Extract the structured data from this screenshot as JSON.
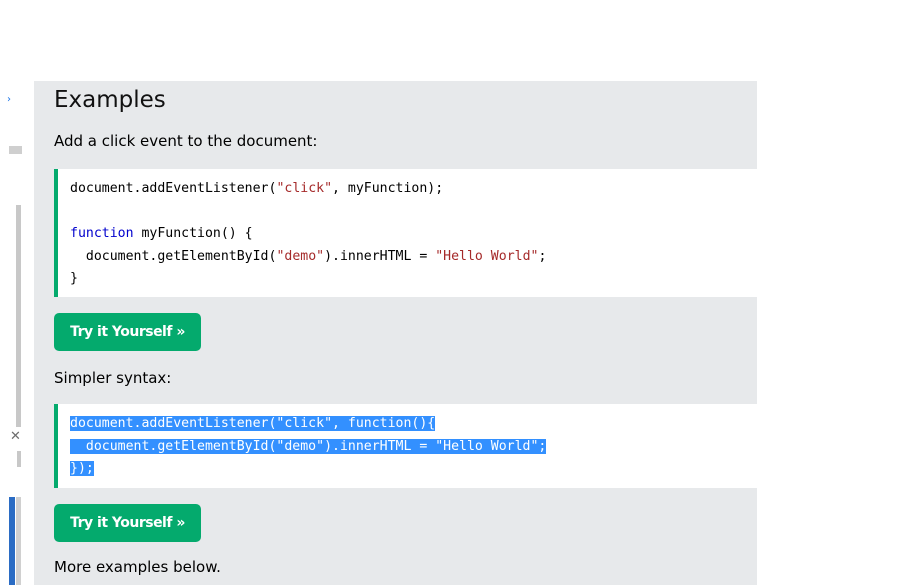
{
  "left_chrome": {
    "close_glyph": "✕"
  },
  "main": {
    "heading": "Examples",
    "intro": "Add a click event to the document:",
    "code1": [
      [
        {
          "t": "document.addEventListener("
        },
        {
          "t": "\"click\"",
          "c": "str"
        },
        {
          "t": ", myFunction);"
        }
      ],
      [],
      [
        {
          "t": "function",
          "c": "kw"
        },
        {
          "t": " myFunction() {"
        }
      ],
      [
        {
          "t": "  document.getElementById("
        },
        {
          "t": "\"demo\"",
          "c": "str"
        },
        {
          "t": ").innerHTML = "
        },
        {
          "t": "\"Hello World\"",
          "c": "str"
        },
        {
          "t": ";"
        }
      ],
      [
        {
          "t": "}"
        }
      ]
    ],
    "try_button_1": "Try it Yourself »",
    "simpler_label": "Simpler syntax:",
    "code2": [
      [
        {
          "t": "document.addEventListener(\"click\", function(){",
          "c": "sel"
        }
      ],
      [
        {
          "t": "  document.getElementById(\"demo\").innerHTML = \"Hello World\";",
          "c": "sel"
        }
      ],
      [
        {
          "t": "});",
          "c": "sel"
        }
      ]
    ],
    "try_button_2": "Try it Yourself »",
    "more_label": "More examples below."
  }
}
